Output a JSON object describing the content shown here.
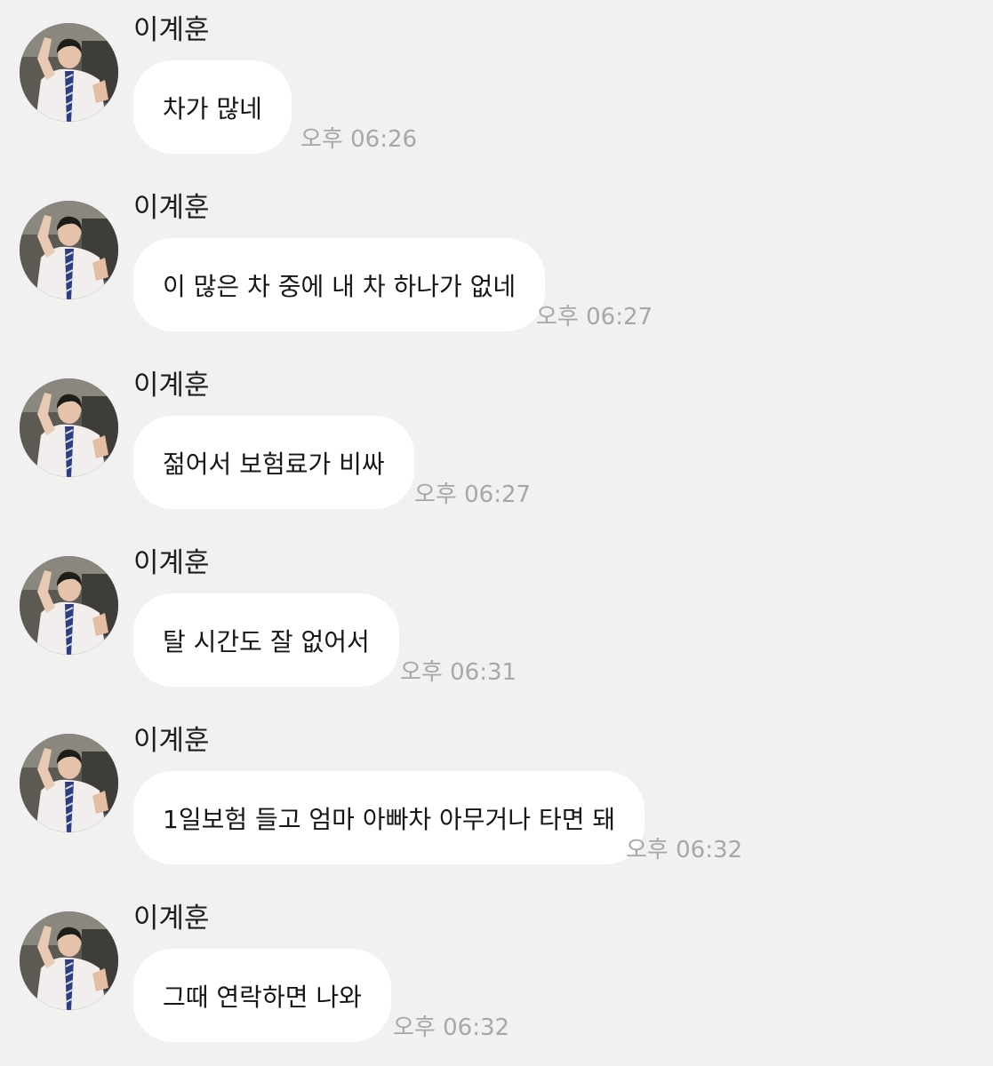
{
  "messages": [
    {
      "sender": "이계훈",
      "text": "차가 많네",
      "time": "오후 06:26"
    },
    {
      "sender": "이계훈",
      "text": "이 많은 차 중에 내 차 하나가 없네",
      "time": "오후 06:27"
    },
    {
      "sender": "이계훈",
      "text": "젊어서 보험료가 비싸",
      "time": "오후 06:27"
    },
    {
      "sender": "이계훈",
      "text": "탈 시간도 잘 없어서",
      "time": "오후 06:31"
    },
    {
      "sender": "이계훈",
      "text": "1일보험 들고 엄마 아빠차 아무거나 타면 돼",
      "time": "오후 06:32"
    },
    {
      "sender": "이계훈",
      "text": "그때 연락하면 나와",
      "time": "오후 06:32"
    }
  ],
  "avatar": {
    "icon": "profile-photo"
  },
  "colors": {
    "background": "#f1f1f1",
    "bubble": "#ffffff",
    "text": "#161616",
    "timestamp": "#a7a7a7"
  }
}
